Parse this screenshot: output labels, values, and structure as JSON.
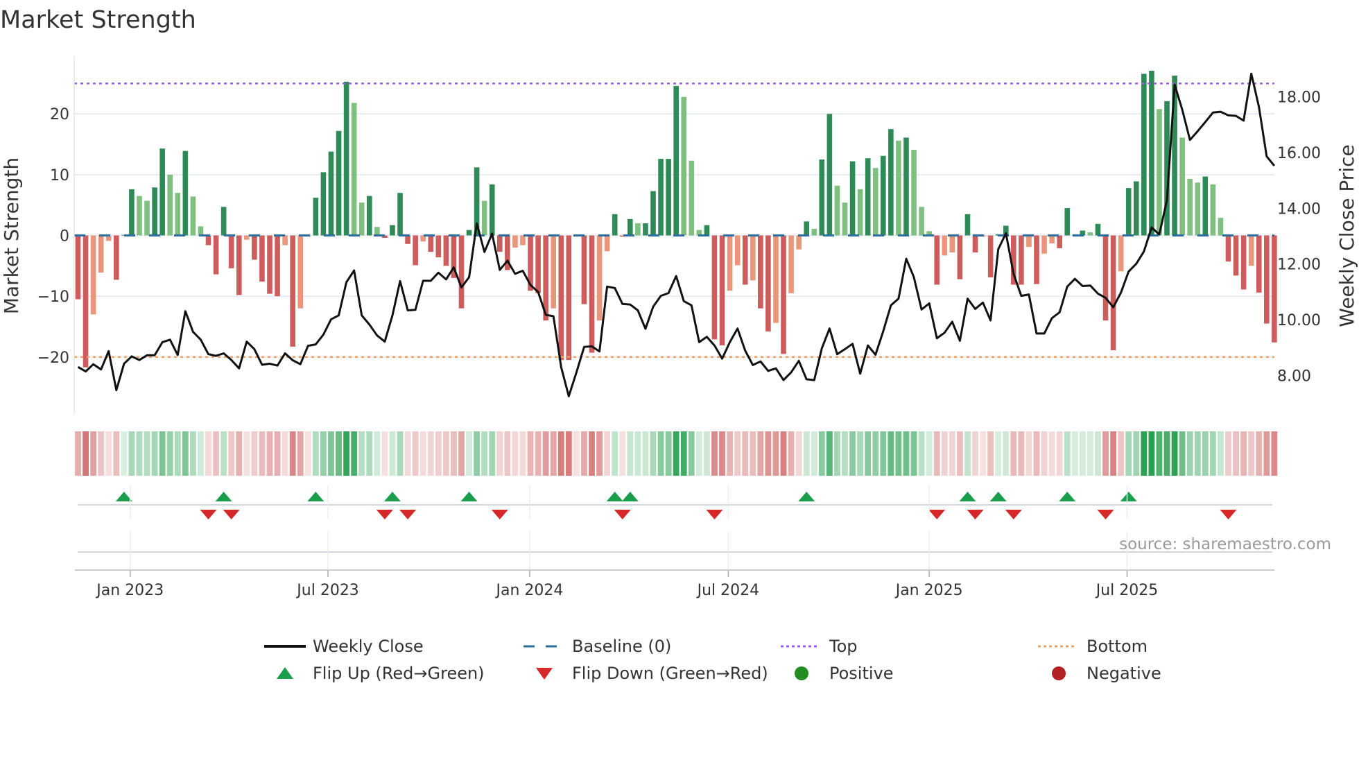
{
  "chart_data": {
    "type": "bar",
    "title": "Market Strength",
    "ylabel": "Market Strength",
    "ylabel_right": "Weekly Close Price",
    "ylim": [
      -29.5,
      29.5
    ],
    "ylim_right": [
      6.6,
      19.45
    ],
    "yticks": [
      {
        "value": 20,
        "label": "20"
      },
      {
        "value": 10,
        "label": "10"
      },
      {
        "value": 0,
        "label": "0"
      },
      {
        "value": -10,
        "label": "−10"
      },
      {
        "value": -20,
        "label": "−20"
      }
    ],
    "yticks_right": [
      {
        "value": 18,
        "label": "18.00"
      },
      {
        "value": 16,
        "label": "16.00"
      },
      {
        "value": 14,
        "label": "14.00"
      },
      {
        "value": 12,
        "label": "12.00"
      },
      {
        "value": 10,
        "label": "10.00"
      },
      {
        "value": 8,
        "label": "8.00"
      }
    ],
    "xticks": [
      {
        "label": "Jan 2023",
        "week": 6.8
      },
      {
        "label": "Jul 2023",
        "week": 32.6
      },
      {
        "label": "Jan 2024",
        "week": 58.9
      },
      {
        "label": "Jul 2024",
        "week": 84.8
      },
      {
        "label": "Jan 2025",
        "week": 111.0
      },
      {
        "label": "Jul 2025",
        "week": 136.8
      }
    ],
    "top_level": 25,
    "bottom_level": -20,
    "baseline": 0,
    "strength": [
      -10.5,
      -21.7,
      -13,
      -6.1,
      -0.9,
      -7.3,
      0.1,
      7.6,
      6.5,
      5.7,
      7.9,
      14.3,
      10,
      7,
      13.9,
      6.4,
      1.5,
      -1.6,
      -6.4,
      4.7,
      -5.4,
      -9.8,
      -0.7,
      -4,
      -7.6,
      -9.6,
      -10,
      -1.6,
      -18.3,
      -12,
      -0.2,
      6.2,
      10.4,
      13.8,
      17.2,
      25.3,
      21.8,
      5.4,
      6.5,
      1.4,
      -0.4,
      1.7,
      7,
      -1.4,
      -4.9,
      -1,
      -2.7,
      -3.6,
      -5,
      -7,
      -12,
      0.9,
      11.2,
      5.7,
      8.4,
      -2.7,
      -5.7,
      -2,
      -1.6,
      -9.1,
      -9.5,
      -14,
      -12,
      -20.5,
      -20.5,
      -0.2,
      -11.3,
      -19.3,
      -14,
      -2.6,
      3.5,
      -0.2,
      2.7,
      2,
      2,
      7.3,
      12.6,
      12.6,
      24.6,
      22.8,
      12.3,
      0.9,
      1.7,
      -17.1,
      -18.1,
      -9.1,
      -4.9,
      -8.1,
      -7.4,
      -12,
      -15.8,
      -14.4,
      -19.5,
      -9.5,
      -2.3,
      2.3,
      1.1,
      12.5,
      20,
      8.2,
      5.4,
      12.2,
      7.6,
      12.7,
      11.1,
      13.1,
      17.5,
      15.6,
      16.1,
      14.1,
      4.7,
      0.7,
      -8.1,
      -3.3,
      -2.8,
      -7.2,
      3.5,
      -2.8,
      -0.2,
      -6.9,
      0.2,
      1.6,
      -8.1,
      -8.1,
      -1.9,
      -8,
      -3,
      -1.3,
      -2.1,
      4.5,
      0.2,
      0.8,
      0.5,
      1.9,
      -14,
      -18.9,
      -5.9,
      7.8,
      8.9,
      26.6,
      27.1,
      20.8,
      22.1,
      26.3,
      16.1,
      9.3,
      8.7,
      9.7,
      8.4,
      2.9,
      -4.3,
      -6.6,
      -8.9,
      -5,
      -9.4,
      -14.5,
      -17.6
    ],
    "weekly_close": [
      8.31,
      8.15,
      8.41,
      8.22,
      8.88,
      7.48,
      8.43,
      8.69,
      8.56,
      8.73,
      8.73,
      9.2,
      9.29,
      8.74,
      10.31,
      9.57,
      9.29,
      8.77,
      8.71,
      8.8,
      8.56,
      8.26,
      9.22,
      8.95,
      8.39,
      8.43,
      8.36,
      8.8,
      8.55,
      8.41,
      9.07,
      9.12,
      9.47,
      10.02,
      10.16,
      11.35,
      11.77,
      10.16,
      9.83,
      9.44,
      9.22,
      10.16,
      11.39,
      10.34,
      10.36,
      11.4,
      11.4,
      11.69,
      11.45,
      11.88,
      11.16,
      11.53,
      13.46,
      12.43,
      13.09,
      11.79,
      12.12,
      11.65,
      11.76,
      11.25,
      11.0,
      10.18,
      10.13,
      8.31,
      7.26,
      8.12,
      9.03,
      9.05,
      8.87,
      11.19,
      11.14,
      10.57,
      10.55,
      10.34,
      9.68,
      10.47,
      10.86,
      10.96,
      11.57,
      10.67,
      10.52,
      9.2,
      9.39,
      9.08,
      8.61,
      9.2,
      9.69,
      8.9,
      8.38,
      8.51,
      8.17,
      8.26,
      7.84,
      8.12,
      8.53,
      7.87,
      7.84,
      8.98,
      9.69,
      8.77,
      8.95,
      9.14,
      8.07,
      9.08,
      8.75,
      9.59,
      10.52,
      10.76,
      12.19,
      11.53,
      10.37,
      10.59,
      9.34,
      9.54,
      9.93,
      9.25,
      10.76,
      10.39,
      10.62,
      9.98,
      12.53,
      13.1,
      11.65,
      10.86,
      10.91,
      9.51,
      9.51,
      10.06,
      10.27,
      11.19,
      11.47,
      11.21,
      11.23,
      10.94,
      10.79,
      10.45,
      10.98,
      11.73,
      12.01,
      12.45,
      13.31,
      13.06,
      14.29,
      18.43,
      17.53,
      16.45,
      16.76,
      17.09,
      17.43,
      17.46,
      17.33,
      17.31,
      17.14,
      18.82,
      17.63,
      15.86,
      15.52
    ],
    "flip_up_weeks": [
      6,
      19,
      31,
      41,
      51,
      70,
      72,
      95,
      116,
      120,
      129,
      137
    ],
    "flip_down_weeks": [
      17,
      20,
      40,
      43,
      55,
      71,
      83,
      112,
      117,
      122,
      134,
      150
    ],
    "legend": [
      {
        "label": "Weekly Close",
        "symbol": "line",
        "color": "#111111"
      },
      {
        "label": "Baseline (0)",
        "symbol": "dash",
        "color": "#2e6e9e"
      },
      {
        "label": "Top",
        "symbol": "dot",
        "color": "#9b5de5"
      },
      {
        "label": "Bottom",
        "symbol": "dot",
        "color": "#f0a060"
      },
      {
        "label": "Flip Up (Red→Green)",
        "symbol": "triangle-up",
        "color": "#1a9e4b"
      },
      {
        "label": "Flip Down (Green→Red)",
        "symbol": "triangle-down",
        "color": "#d62828"
      },
      {
        "label": "Positive",
        "symbol": "circle",
        "color": "#228b22"
      },
      {
        "label": "Negative",
        "symbol": "circle",
        "color": "#b22222"
      }
    ],
    "legend_placement": "bottom",
    "source": "source: sharemaestro.com",
    "colors": {
      "pos_strong": "#2e8b57",
      "pos_weak": "#7fbf7f",
      "neg_strong": "#cd5c5c",
      "neg_weak": "#e9967a"
    }
  }
}
